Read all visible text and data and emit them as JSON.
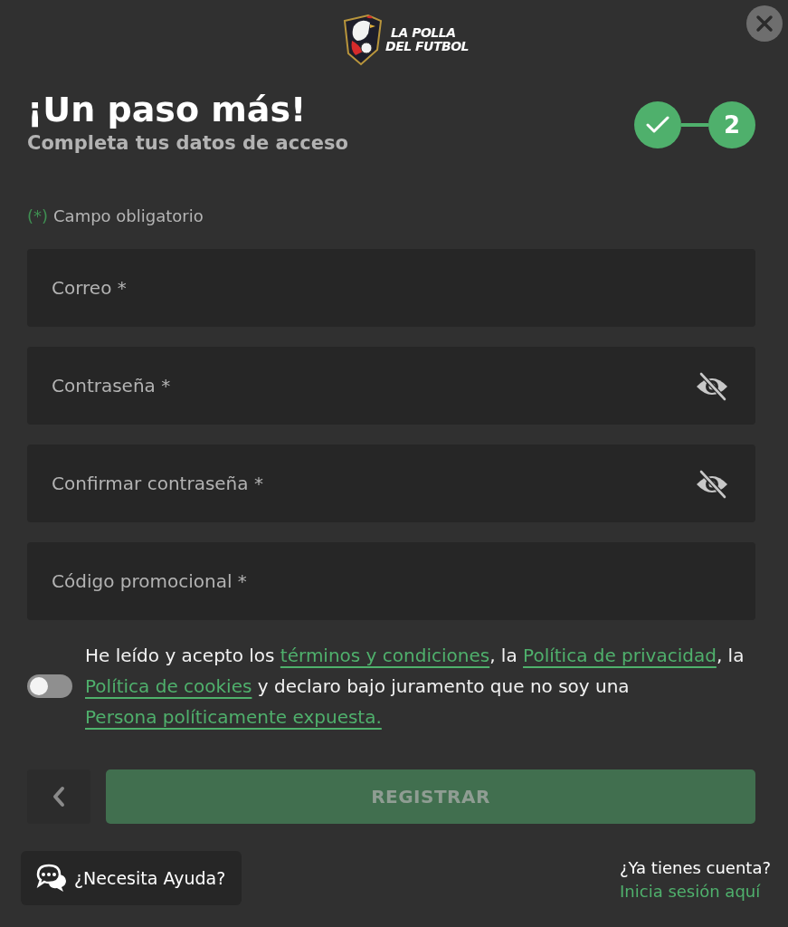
{
  "logo": {
    "lines": [
      "LA POLLA",
      "DEL FUTBOL"
    ]
  },
  "header": {
    "title": "¡Un paso más!",
    "subtitle": "Completa tus datos de acceso"
  },
  "steps": [
    {
      "completed": true
    },
    {
      "completed": false,
      "label": "2"
    }
  ],
  "required_note": {
    "marker": "(*)",
    "text": "Campo obligatorio"
  },
  "fields": [
    {
      "kind": "email",
      "placeholder": "Correo *"
    },
    {
      "kind": "password",
      "placeholder": "Contraseña *",
      "visible": false
    },
    {
      "kind": "password",
      "placeholder": "Confirmar contraseña *",
      "visible": false
    },
    {
      "kind": "text",
      "placeholder": "Código promocional *"
    }
  ],
  "consent": {
    "on": false,
    "parts": [
      {
        "kind": "text",
        "text": "He leído y acepto los "
      },
      {
        "kind": "link",
        "text": "términos y condiciones"
      },
      {
        "kind": "text",
        "text": ", la "
      },
      {
        "kind": "link",
        "text": "Política de privacidad"
      },
      {
        "kind": "text",
        "text": ", la "
      },
      {
        "kind": "link",
        "text": "Política de cookies"
      },
      {
        "kind": "text",
        "text": " y declaro bajo juramento que no soy una "
      },
      {
        "kind": "link",
        "text": "Persona políticamente expuesta."
      }
    ]
  },
  "register_button": {
    "label": "REGISTRAR",
    "disabled": true
  },
  "help_button": {
    "label": "¿Necesita Ayuda?"
  },
  "login_prompt": {
    "question": "¿Ya tienes cuenta?",
    "link": "Inicia sesión aquí"
  }
}
